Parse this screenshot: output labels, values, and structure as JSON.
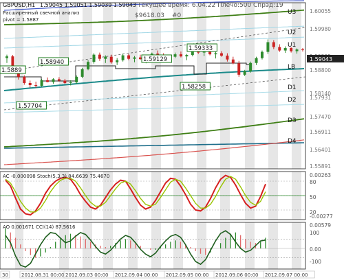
{
  "header": {
    "symbol": "GBPUSD,H1",
    "ohlc": "1.59045 1.59051 1.59039 1.59043",
    "subtitle_1": "Расширенный свечной анализ",
    "pivot_label": "pivot = 1.5887",
    "server_time": "Текущее время: 6.04.22  Плечо:500  Спрэд:19",
    "balance": "$9618.03",
    "balance_suffix": "#0"
  },
  "colors": {
    "bull": "#2e8b2e",
    "bear": "#cc2222",
    "lb_line": "#1b8a8a",
    "d4_line": "#1f6f8b",
    "level_green": "#3f7f16",
    "red_line": "#d9534f",
    "blue_line": "#3f56c8",
    "price_box": "#1a7a1a"
  },
  "level_labels": [
    "U3",
    "U2",
    "U1",
    "LB",
    "D1",
    "D2",
    "D3",
    "D4"
  ],
  "price_axis": [
    "1.60055",
    "1.59980",
    "1.59525",
    "1.59043",
    "1.58800",
    "1.58140",
    "1.57931",
    "1.57470",
    "1.56911",
    "1.56401",
    "1.55891"
  ],
  "price_markers": [
    "1.58940",
    "1.59129",
    "1.59333",
    "1.58258",
    "1.57704",
    "1.5889"
  ],
  "main_chart": {
    "ylim": [
      1.556,
      1.604
    ],
    "candles_ohlc": [
      [
        1.588,
        1.589,
        1.5866,
        1.5885
      ],
      [
        1.5885,
        1.5889,
        1.5838,
        1.5845
      ],
      [
        1.5845,
        1.585,
        1.5818,
        1.5826
      ],
      [
        1.5826,
        1.583,
        1.5803,
        1.5808
      ],
      [
        1.5808,
        1.5815,
        1.5795,
        1.5802
      ],
      [
        1.5802,
        1.5812,
        1.5794,
        1.58
      ],
      [
        1.58,
        1.582,
        1.5797,
        1.5816
      ],
      [
        1.5816,
        1.5824,
        1.581,
        1.5811
      ],
      [
        1.5811,
        1.5822,
        1.5806,
        1.5819
      ],
      [
        1.5819,
        1.5825,
        1.5812,
        1.5815
      ],
      [
        1.5815,
        1.582,
        1.5805,
        1.5808
      ],
      [
        1.5808,
        1.5816,
        1.5801,
        1.581
      ],
      [
        1.581,
        1.583,
        1.5806,
        1.5826
      ],
      [
        1.5826,
        1.5852,
        1.5822,
        1.5848
      ],
      [
        1.5848,
        1.5874,
        1.5845,
        1.5869
      ],
      [
        1.5869,
        1.5894,
        1.5864,
        1.589
      ],
      [
        1.589,
        1.5896,
        1.5872,
        1.5878
      ],
      [
        1.5878,
        1.5888,
        1.5866,
        1.5884
      ],
      [
        1.5884,
        1.589,
        1.5864,
        1.5868
      ],
      [
        1.5868,
        1.588,
        1.586,
        1.5874
      ],
      [
        1.5874,
        1.5893,
        1.587,
        1.5888
      ],
      [
        1.5888,
        1.5892,
        1.5874,
        1.5878
      ],
      [
        1.5878,
        1.5886,
        1.5868,
        1.5882
      ],
      [
        1.5882,
        1.589,
        1.5875,
        1.5877
      ],
      [
        1.5877,
        1.5884,
        1.5865,
        1.588
      ],
      [
        1.588,
        1.5896,
        1.5877,
        1.5893
      ],
      [
        1.5893,
        1.5902,
        1.5885,
        1.5888
      ],
      [
        1.5888,
        1.5894,
        1.5876,
        1.588
      ],
      [
        1.588,
        1.5887,
        1.5868,
        1.5884
      ],
      [
        1.5884,
        1.5896,
        1.588,
        1.5891
      ],
      [
        1.5891,
        1.5899,
        1.5882,
        1.5885
      ],
      [
        1.5885,
        1.5892,
        1.5874,
        1.5889
      ],
      [
        1.5889,
        1.5908,
        1.5885,
        1.5904
      ],
      [
        1.5904,
        1.5913,
        1.5892,
        1.5896
      ],
      [
        1.5896,
        1.5904,
        1.5886,
        1.59
      ],
      [
        1.59,
        1.5906,
        1.5888,
        1.5891
      ],
      [
        1.5891,
        1.5898,
        1.5879,
        1.5894
      ],
      [
        1.5894,
        1.59,
        1.5884,
        1.5887
      ],
      [
        1.5887,
        1.5894,
        1.587,
        1.5876
      ],
      [
        1.5876,
        1.5884,
        1.5862,
        1.5865
      ],
      [
        1.5865,
        1.5872,
        1.5826,
        1.5832
      ],
      [
        1.5832,
        1.5846,
        1.5828,
        1.5842
      ],
      [
        1.5842,
        1.587,
        1.5838,
        1.5866
      ],
      [
        1.5866,
        1.5884,
        1.586,
        1.588
      ],
      [
        1.588,
        1.5902,
        1.5876,
        1.5898
      ],
      [
        1.5898,
        1.5934,
        1.5892,
        1.5926
      ],
      [
        1.5926,
        1.5932,
        1.5906,
        1.5912
      ],
      [
        1.5912,
        1.592,
        1.5898,
        1.5902
      ],
      [
        1.5902,
        1.5914,
        1.5895,
        1.5909
      ],
      [
        1.5909,
        1.5912,
        1.5896,
        1.59
      ],
      [
        1.59,
        1.5908,
        1.5893,
        1.5905
      ],
      [
        1.5905,
        1.5909,
        1.5899,
        1.5904
      ]
    ]
  },
  "ac_panel": {
    "label": "AC -0.000098  Stoch(5,3,3) 84.6639 75.4670",
    "axis": [
      "0.00263",
      "80",
      "50",
      "20",
      "-0.00277"
    ],
    "stoch_main": [
      82,
      70,
      45,
      22,
      12,
      10,
      18,
      34,
      55,
      70,
      80,
      86,
      88,
      84,
      70,
      52,
      38,
      26,
      22,
      30,
      46,
      62,
      74,
      82,
      80,
      64,
      46,
      30,
      22,
      26,
      40,
      58,
      76,
      86,
      84,
      70,
      52,
      32,
      20,
      18,
      26,
      44,
      66,
      84,
      92,
      88,
      72,
      52,
      34,
      24,
      28,
      48,
      74
    ],
    "stoch_signal": [
      84,
      76,
      58,
      38,
      24,
      16,
      16,
      24,
      40,
      58,
      72,
      82,
      86,
      86,
      80,
      66,
      50,
      36,
      28,
      28,
      36,
      50,
      64,
      76,
      80,
      74,
      60,
      44,
      32,
      28,
      32,
      46,
      62,
      78,
      84,
      80,
      66,
      50,
      34,
      24,
      24,
      32,
      48,
      68,
      84,
      90,
      84,
      68,
      50,
      36,
      30,
      38,
      58
    ]
  },
  "cci_panel": {
    "label": "AO 0.001671  CCI(14) 87.5616",
    "axis": [
      "0.00579",
      "100",
      "0.00",
      "-100"
    ],
    "cci": [
      140,
      60,
      -80,
      -180,
      -200,
      -160,
      -60,
      40,
      120,
      170,
      160,
      110,
      60,
      80,
      130,
      170,
      150,
      90,
      20,
      -40,
      -60,
      -20,
      40,
      100,
      140,
      120,
      60,
      -10,
      -60,
      -90,
      -50,
      20,
      80,
      130,
      150,
      120,
      40,
      -60,
      -140,
      -170,
      -120,
      -20,
      80,
      160,
      190,
      150,
      70,
      0,
      -40,
      -20,
      30,
      80,
      90
    ],
    "ao": [
      0.003,
      0.0024,
      0.0016,
      0.0006,
      -0.0004,
      -0.001,
      -0.0014,
      -0.0012,
      -0.0006,
      0.0002,
      0.001,
      0.0016,
      0.002,
      0.0022,
      0.002,
      0.0018,
      0.0014,
      0.001,
      0.0006,
      0.0004,
      0.0002,
      0.0004,
      0.0008,
      0.0012,
      0.0014,
      0.0012,
      0.0008,
      0.0004,
      0.0,
      -0.0002,
      -0.0002,
      0.0002,
      0.0006,
      0.001,
      0.0012,
      0.001,
      0.0006,
      0.0002,
      -0.0004,
      -0.0008,
      -0.001,
      -0.0006,
      0.0,
      0.0008,
      0.0016,
      0.0022,
      0.0024,
      0.002,
      0.0014,
      0.001,
      0.0008,
      0.001,
      0.0016
    ]
  },
  "time_axis": [
    "30",
    "2012.08.31 00:00",
    "2012.09.03 00:00",
    "2012.09.04 00:00",
    "2012.09.05 00:00",
    "2012.09.06 00:00",
    "2012.09.07 00:00"
  ]
}
